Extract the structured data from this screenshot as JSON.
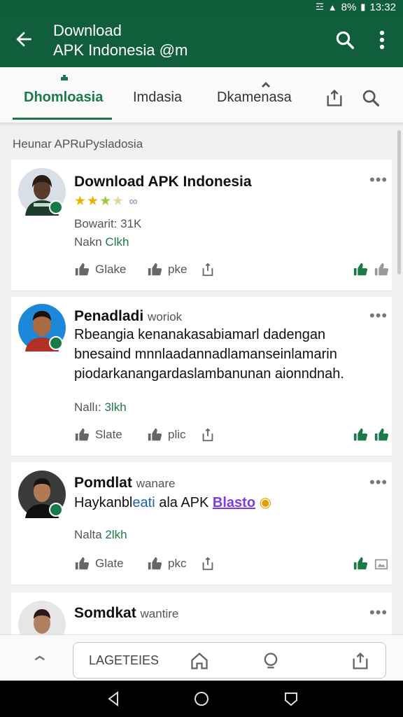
{
  "status": {
    "percent": "8%",
    "time": "13:32"
  },
  "app_bar": {
    "title_line1": "Download",
    "title_line2": "APK Indonesia @m"
  },
  "tabs": [
    {
      "label": "Dhomloasia",
      "active": true
    },
    {
      "label": "Imdasia"
    },
    {
      "label": "Dkamenasa"
    }
  ],
  "section": {
    "label": "Heunar APRuPysladosia"
  },
  "posts": [
    {
      "title": "Download APK Indonesia",
      "sub": "",
      "rating_stars": 3.5,
      "meta1": "Bowarit: 31K",
      "meta2_prefix": "Nakn ",
      "meta2_value": "Clkh",
      "actions": {
        "like": "Glake",
        "dislike": "pke"
      }
    },
    {
      "title": "Penadladi",
      "sub": "woriok",
      "body": "Rbeangia kenanakasabiamarl dadengan bnesaind mnnlaadannadlamanseinlamarin piodarkanangardaslambanunan aionndnah.",
      "meta_prefix": "Nallı: ",
      "meta_value": "3lkh",
      "actions": {
        "like": "Slate",
        "dislike": "plic"
      }
    },
    {
      "title": "Pomdlat",
      "sub": "wanare",
      "body_prefix": "Haykanbl",
      "body_blue": "eati",
      "body_mid": " ala APK ",
      "body_link": "Blasto",
      "meta_prefix": "Nalta ",
      "meta_value": "2lkh",
      "actions": {
        "like": "Glate",
        "dislike": "pkc"
      }
    },
    {
      "title": "Somdkat",
      "sub": "wantire"
    }
  ],
  "bottom_bar": {
    "pill_label": "LAGETEIES"
  },
  "colors": {
    "brand": "#115e3d",
    "accent": "#1a7a47",
    "link": "#7c3aed"
  },
  "icons": [
    "back-arrow-icon",
    "search-icon",
    "more-vert-icon",
    "share-icon",
    "thumbs-up-icon",
    "thumbs-down-icon",
    "home-icon",
    "chat-icon",
    "nav-back-icon",
    "nav-home-icon",
    "nav-recents-icon"
  ]
}
